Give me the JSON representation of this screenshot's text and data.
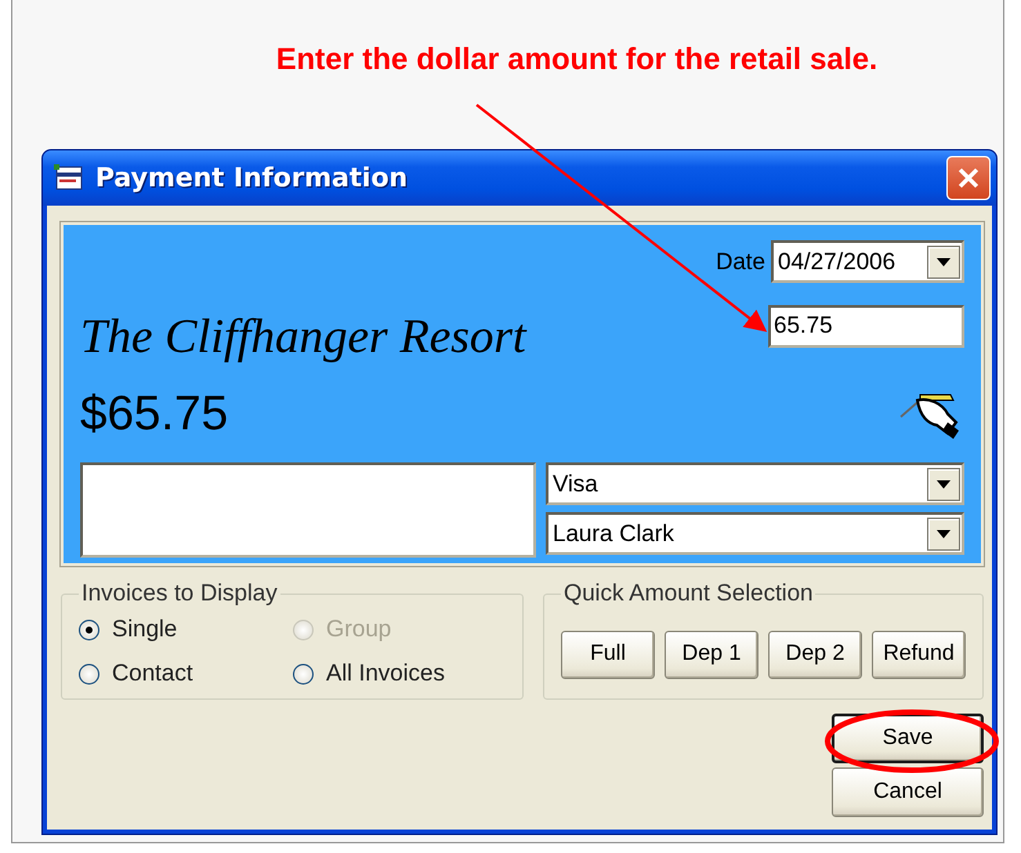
{
  "annotation": {
    "text": "Enter the dollar amount for the retail sale."
  },
  "window": {
    "title": "Payment Information"
  },
  "header": {
    "date_label": "Date",
    "date": "04/27/2006",
    "amount": "65.75",
    "business_name": "The Cliffhanger Resort",
    "total": "$65.75"
  },
  "payment": {
    "method": "Visa",
    "payer": "Laura Clark"
  },
  "invoices_to_display": {
    "title": "Invoices to Display",
    "options": [
      {
        "label": "Single",
        "selected": true,
        "disabled": false
      },
      {
        "label": "Group",
        "selected": false,
        "disabled": true
      },
      {
        "label": "Contact",
        "selected": false,
        "disabled": false
      },
      {
        "label": "All Invoices",
        "selected": false,
        "disabled": false
      }
    ]
  },
  "quick_amount": {
    "title": "Quick Amount Selection",
    "buttons": [
      "Full",
      "Dep 1",
      "Dep 2",
      "Refund"
    ]
  },
  "actions": [
    {
      "label": "Save",
      "default": true,
      "highlighted": true
    },
    {
      "label": "Cancel",
      "default": false,
      "highlighted": false
    }
  ]
}
